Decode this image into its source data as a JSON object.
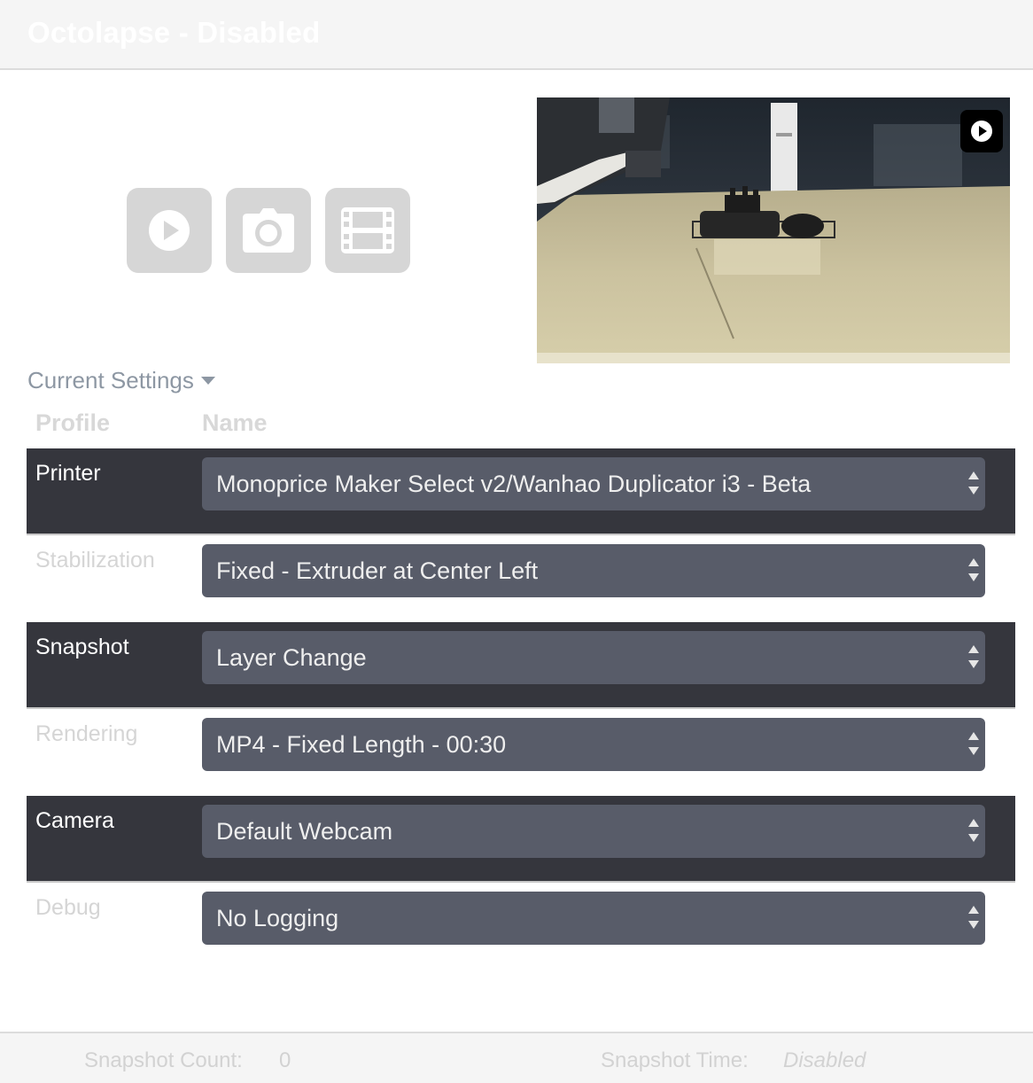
{
  "header": {
    "title": "Octolapse - Disabled"
  },
  "controls": [
    {
      "icon": "play-circle-icon"
    },
    {
      "icon": "camera-icon"
    },
    {
      "icon": "film-icon"
    }
  ],
  "preview": {
    "play_icon": "play-circle-icon"
  },
  "settings": {
    "toggle_label": "Current Settings",
    "col_profile": "Profile",
    "col_name": "Name",
    "rows": [
      {
        "label": "Printer",
        "value": "Monoprice Maker Select v2/Wanhao Duplicator i3 - Beta"
      },
      {
        "label": "Stabilization",
        "value": "Fixed - Extruder at Center Left"
      },
      {
        "label": "Snapshot",
        "value": "Layer Change"
      },
      {
        "label": "Rendering",
        "value": "MP4 - Fixed Length - 00:30"
      },
      {
        "label": "Camera",
        "value": "Default Webcam"
      },
      {
        "label": "Debug",
        "value": "No Logging"
      }
    ]
  },
  "footer": {
    "count_label": "Snapshot Count:",
    "count_value": "0",
    "time_label": "Snapshot Time:",
    "time_value": "Disabled"
  },
  "colors": {
    "dark_row": "#35363d",
    "select_bg": "#585c69",
    "button_bg": "#d6d6d6",
    "muted_text": "#8d97a3"
  }
}
